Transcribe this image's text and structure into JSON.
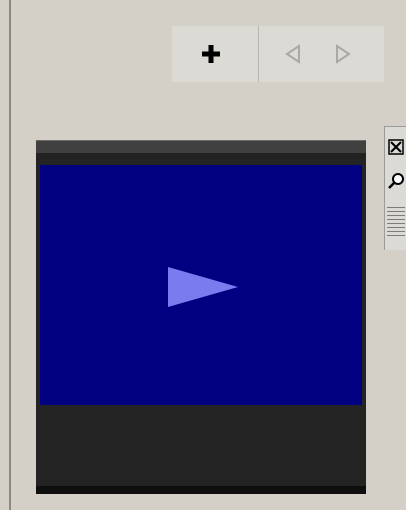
{
  "toolbar": {
    "add_icon": "plus-icon",
    "prev_icon": "triangle-left-icon",
    "next_icon": "triangle-right-icon"
  },
  "player": {
    "play_icon": "play-triangle-icon",
    "screen_color": "#000080",
    "play_color": "#7b7bf0"
  },
  "side_panel": {
    "close_icon": "close-x-icon",
    "search_icon": "magnifier-icon",
    "grip_icon": "grip-lines-icon"
  }
}
